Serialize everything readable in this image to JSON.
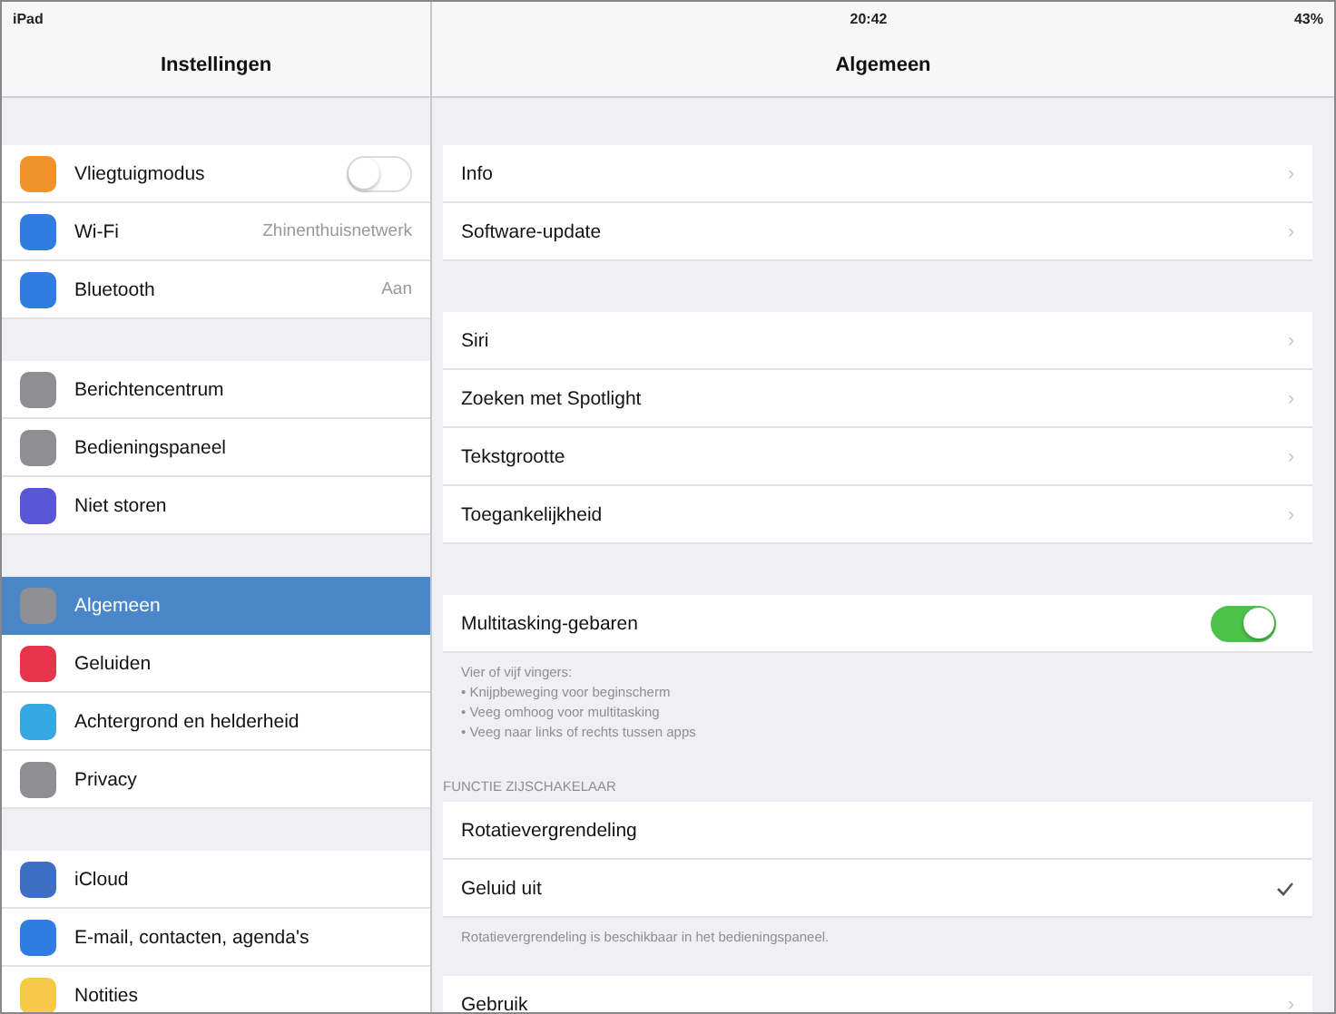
{
  "status_bar": {
    "device": "iPad",
    "time": "20:42",
    "battery": "43%"
  },
  "sidebar": {
    "title": "Instellingen",
    "groups": [
      [
        {
          "label": "Vliegtuigmodus",
          "color": "#f0932b",
          "kind": "toggle",
          "on": false,
          "selected": false
        },
        {
          "label": "Wi-Fi",
          "color": "#2f7de1",
          "kind": "value",
          "value": "Zhinenthuisnetwerk",
          "selected": false
        },
        {
          "label": "Bluetooth",
          "color": "#2f7de1",
          "kind": "value",
          "value": "Aan",
          "selected": false
        }
      ],
      [
        {
          "label": "Berichtencentrum",
          "color": "#8e8e93",
          "kind": "link",
          "selected": false
        },
        {
          "label": "Bedieningspaneel",
          "color": "#8e8e93",
          "kind": "link",
          "selected": false
        },
        {
          "label": "Niet storen",
          "color": "#5856d6",
          "kind": "link",
          "selected": false
        }
      ],
      [
        {
          "label": "Algemeen",
          "color": "#8e8e93",
          "kind": "link",
          "selected": true
        },
        {
          "label": "Geluiden",
          "color": "#e8344a",
          "kind": "link",
          "selected": false
        },
        {
          "label": "Achtergrond en helderheid",
          "color": "#36a7e0",
          "kind": "link",
          "selected": false
        },
        {
          "label": "Privacy",
          "color": "#8e8e93",
          "kind": "link",
          "selected": false
        }
      ],
      [
        {
          "label": "iCloud",
          "color": "#3d6fc4",
          "kind": "link",
          "selected": false
        },
        {
          "label": "E-mail, contacten, agenda's",
          "color": "#2f7de1",
          "kind": "link",
          "selected": false
        },
        {
          "label": "Notities",
          "color": "#f7c948",
          "kind": "link",
          "selected": false
        }
      ]
    ]
  },
  "detail": {
    "title": "Algemeen",
    "groups": [
      {
        "rows": [
          {
            "label": "Info",
            "kind": "link",
            "chevron": "›"
          },
          {
            "label": "Software-update",
            "kind": "link",
            "chevron": "›"
          }
        ]
      },
      {
        "rows": [
          {
            "label": "Siri",
            "kind": "link",
            "chevron": "›"
          },
          {
            "label": "Zoeken met Spotlight",
            "kind": "link",
            "chevron": "›"
          },
          {
            "label": "Tekstgrootte",
            "kind": "link",
            "chevron": "›"
          },
          {
            "label": "Toegankelijkheid",
            "kind": "link",
            "chevron": "›"
          }
        ]
      },
      {
        "rows": [
          {
            "label": "Multitasking-gebaren",
            "kind": "toggle",
            "on": true
          }
        ],
        "footer": [
          "Vier of vijf vingers:",
          "• Knijpbeweging voor beginscherm",
          "• Veeg omhoog voor multitasking",
          "• Veeg naar links of rechts tussen apps"
        ]
      },
      {
        "header": "FUNCTIE ZIJSCHAKELAAR",
        "rows": [
          {
            "label": "Rotatievergrendeling",
            "kind": "check",
            "checked": false
          },
          {
            "label": "Geluid uit",
            "kind": "check",
            "checked": true
          }
        ],
        "footer": [
          "Rotatievergrendeling is beschikbaar in het bedieningspaneel."
        ]
      },
      {
        "rows": [
          {
            "label": "Gebruik",
            "kind": "link",
            "chevron": "›"
          }
        ]
      }
    ]
  }
}
